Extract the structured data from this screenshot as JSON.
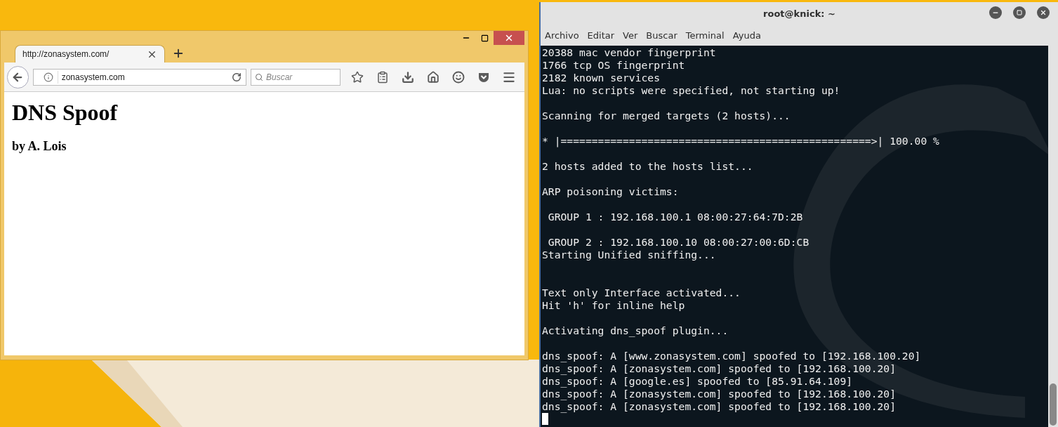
{
  "browser": {
    "tab": {
      "title": "http://zonasystem.com/",
      "selected": true
    },
    "address": {
      "value": "zonasystem.com"
    },
    "search": {
      "placeholder": "Buscar"
    },
    "page": {
      "heading": "DNS Spoof",
      "byline": "by A. Lois"
    }
  },
  "terminal": {
    "title": "root@knick: ~",
    "menu": [
      "Archivo",
      "Editar",
      "Ver",
      "Buscar",
      "Terminal",
      "Ayuda"
    ],
    "lines": [
      {
        "kind": "text",
        "text": "20388 mac vendor fingerprint"
      },
      {
        "kind": "text",
        "text": "1766 tcp OS fingerprint"
      },
      {
        "kind": "text",
        "text": "2182 known services"
      },
      {
        "kind": "text",
        "text": "Lua: no scripts were specified, not starting up!"
      },
      {
        "kind": "blank"
      },
      {
        "kind": "text",
        "text": "Scanning for merged targets (2 hosts)..."
      },
      {
        "kind": "blank"
      },
      {
        "kind": "text",
        "text": "* |==================================================>| 100.00 %"
      },
      {
        "kind": "blank"
      },
      {
        "kind": "text",
        "text": "2 hosts added to the hosts list..."
      },
      {
        "kind": "blank"
      },
      {
        "kind": "text",
        "text": "ARP poisoning victims:"
      },
      {
        "kind": "blank"
      },
      {
        "kind": "text",
        "text": " GROUP 1 : 192.168.100.1 08:00:27:64:7D:2B"
      },
      {
        "kind": "blank"
      },
      {
        "kind": "text",
        "text": " GROUP 2 : 192.168.100.10 08:00:27:00:6D:CB"
      },
      {
        "kind": "text",
        "text": "Starting Unified sniffing..."
      },
      {
        "kind": "blank"
      },
      {
        "kind": "blank"
      },
      {
        "kind": "text",
        "text": "Text only Interface activated..."
      },
      {
        "kind": "text",
        "text": "Hit 'h' for inline help"
      },
      {
        "kind": "blank"
      },
      {
        "kind": "text",
        "text": "Activating dns_spoof plugin..."
      },
      {
        "kind": "blank"
      },
      {
        "kind": "text",
        "text": "dns_spoof: A [www.zonasystem.com] spoofed to [192.168.100.20]"
      },
      {
        "kind": "text",
        "text": "dns_spoof: A [zonasystem.com] spoofed to [192.168.100.20]"
      },
      {
        "kind": "text",
        "text": "dns_spoof: A [google.es] spoofed to [85.91.64.109]"
      },
      {
        "kind": "text",
        "text": "dns_spoof: A [zonasystem.com] spoofed to [192.168.100.20]"
      },
      {
        "kind": "text",
        "text": "dns_spoof: A [zonasystem.com] spoofed to [192.168.100.20]"
      }
    ],
    "cursor_visible": true
  }
}
